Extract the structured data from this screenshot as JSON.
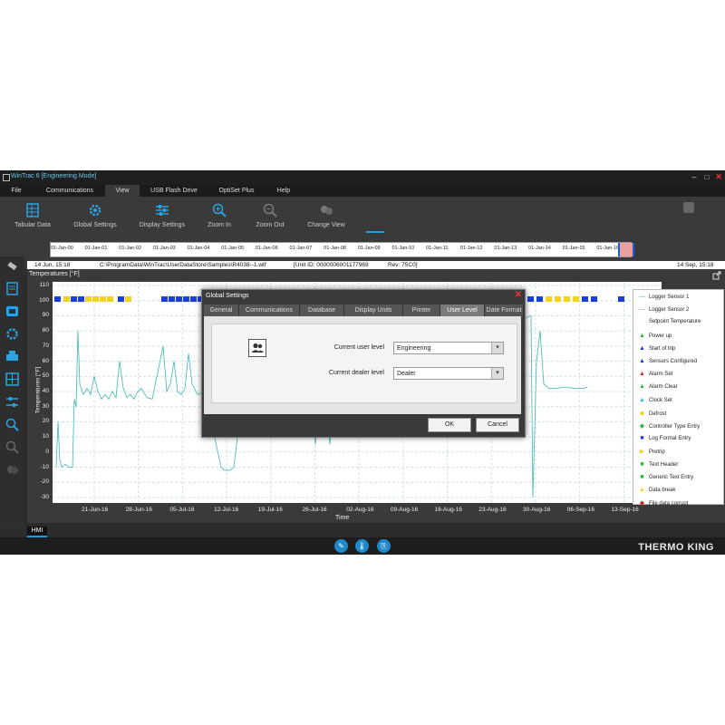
{
  "window": {
    "title": "WinTrac 6 [Engineering Mode]"
  },
  "menu": [
    "File",
    "Communications",
    "View",
    "USB Flash Drive",
    "OptiSet Plus",
    "Help"
  ],
  "ribbon": [
    "Tabular Data",
    "Global Settings",
    "Display Settings",
    "Zoom In",
    "Zoom Out",
    "Change View"
  ],
  "timeline": {
    "ticks": [
      "01-Jan-00",
      "01-Jan-01",
      "01-Jan-02",
      "01-Jan-03",
      "01-Jan-04",
      "01-Jan-05",
      "01-Jan-06",
      "01-Jan-07",
      "01-Jan-08",
      "01-Jan-09",
      "01-Jan-10",
      "01-Jan-11",
      "01-Jan-12",
      "01-Jan-13",
      "01-Jan-14",
      "01-Jan-15",
      "01-Jan-16"
    ]
  },
  "pathbar": {
    "start": "14 Jun, 15:18",
    "path": "C:\\ProgramData\\WinTrac\\UserDataStore\\Samples\\R4038--1.wtf",
    "unit": "[Unit ID: 0000006001177969",
    "rev": "Rev: 75C0]",
    "end": "14 Sep, 15:18"
  },
  "chart_data": {
    "type": "line",
    "title": "Temperatures [°F]",
    "ylabel": "Temperatures [°F]",
    "xlabel": "Time",
    "yticks": [
      110,
      100,
      90,
      80,
      70,
      60,
      50,
      40,
      30,
      20,
      10,
      0,
      -10,
      -20,
      -30
    ],
    "xticks": [
      "21-Jun-16",
      "28-Jun-16",
      "05-Jul-16",
      "12-Jul-16",
      "19-Jul-16",
      "26-Jul-16",
      "02-Aug-16",
      "09-Aug-16",
      "16-Aug-16",
      "23-Aug-16",
      "30-Aug-16",
      "06-Sep-16",
      "13-Sep-16"
    ],
    "ylim": [
      -30,
      110
    ],
    "grid": true,
    "series_color": "#3fb8b0"
  },
  "legend": [
    {
      "label": "Logger Sensor 1",
      "sym": "—",
      "color": "#3fb8b0"
    },
    {
      "label": "Logger Sensor 2",
      "sym": "—",
      "color": "#999999"
    },
    {
      "label": "Setpoint Temperature",
      "sym": "",
      "color": "#ffffff"
    },
    {
      "label": "Power up",
      "sym": "▲",
      "color": "#22bb33"
    },
    {
      "label": "Start of trip",
      "sym": "▲",
      "color": "#1a3fd8"
    },
    {
      "label": "Sensors Configured",
      "sym": "▲",
      "color": "#1a3fd8"
    },
    {
      "label": "Alarm Set",
      "sym": "▲",
      "color": "#e02020"
    },
    {
      "label": "Alarm Clear",
      "sym": "▲",
      "color": "#22bb33"
    },
    {
      "label": "Clock Set",
      "sym": "▲",
      "color": "#27c3e0"
    },
    {
      "label": "Defrost",
      "sym": "◆",
      "color": "#f2d21a"
    },
    {
      "label": "Controller Type Entry",
      "sym": "◆",
      "color": "#22bb33"
    },
    {
      "label": "Log Format Entry",
      "sym": "■",
      "color": "#1a3fd8"
    },
    {
      "label": "Pretrip",
      "sym": "▶",
      "color": "#f2d21a"
    },
    {
      "label": "Text Header",
      "sym": "■",
      "color": "#22bb33"
    },
    {
      "label": "Generic Text Entry",
      "sym": "■",
      "color": "#22bb33"
    },
    {
      "label": "Data break",
      "sym": "▲",
      "color": "#f2d21a"
    },
    {
      "label": "File data corrupt",
      "sym": "◆",
      "color": "#e02020"
    }
  ],
  "hmi": "HMI",
  "brand": "THERMO KING",
  "dialog": {
    "title": "Global Settings",
    "tabs": [
      "General",
      "Communications",
      "Database",
      "Display Units",
      "Printer",
      "User Level",
      "Date Format"
    ],
    "active_tab": "User Level",
    "user_level_label": "Current user level",
    "user_level_value": "Engineering",
    "dealer_level_label": "Current dealer level",
    "dealer_level_value": "Dealer",
    "ok": "OK",
    "cancel": "Cancel"
  }
}
